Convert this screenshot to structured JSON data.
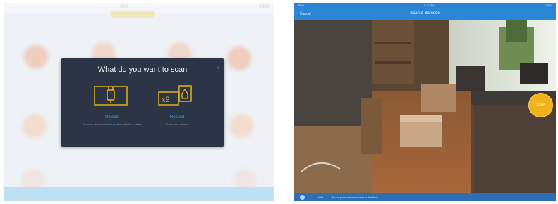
{
  "left_screen": {
    "status_time": "9:41",
    "status_battery": "100%",
    "dialog": {
      "title": "What do you want to scan",
      "close_glyph": "×",
      "options": [
        {
          "label": "Objects",
          "description": "Scan an object and find product details & offers",
          "icon": "product-scan-icon"
        },
        {
          "label": "Receipt",
          "description": "Scan your receipt",
          "icon": "receipt-scan-icon"
        }
      ]
    }
  },
  "right_screen": {
    "status_left": "iPad",
    "status_time": "9:41 AM",
    "status_battery": "100%",
    "nav": {
      "cancel": "Cancel",
      "title": "Scan a Barcode"
    },
    "shutter_label": "SCAN",
    "bottom": {
      "left_label": "Hint",
      "text": "Move your camera closer to the item"
    },
    "colors": {
      "accent": "#2b86d6",
      "shutter": "#f2b21b"
    }
  }
}
